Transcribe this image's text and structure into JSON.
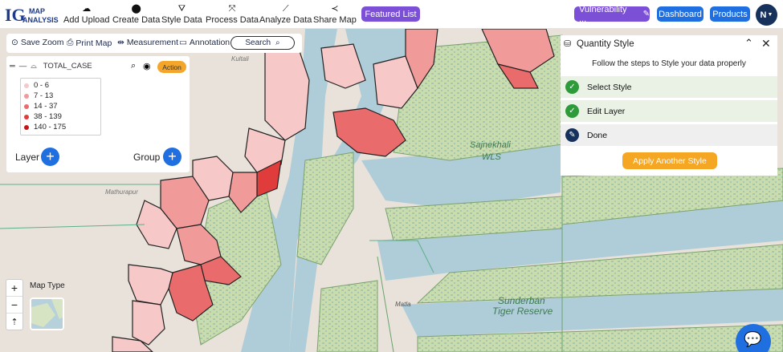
{
  "topbar": {
    "logo_main": "IG",
    "logo_line1": "MAP",
    "logo_line2": "ANALYSIS",
    "nav": [
      {
        "label": "Add Upload",
        "icon": "cloud-upload-icon"
      },
      {
        "label": "Create Data",
        "icon": "pin-icon"
      },
      {
        "label": "Style Data",
        "icon": "paint-bucket-icon"
      },
      {
        "label": "Process Data",
        "icon": "process-icon"
      },
      {
        "label": "Analyze Data",
        "icon": "analyze-icon"
      },
      {
        "label": "Share Map",
        "icon": "share-icon"
      }
    ],
    "featured": "Featured List",
    "project": "Vulnerability ...",
    "dashboard": "Dashboard",
    "products": "Products",
    "avatar": "N",
    "colors": {
      "featured": "#7b4fd6",
      "project": "#7b4fd6",
      "dashboard": "#1f6fe0",
      "products": "#1f6fe0"
    }
  },
  "tools": {
    "save_zoom": "Save Zoom",
    "print_map": "Print Map",
    "measurement": "Measurement",
    "annotation": "Annotation",
    "search": "Search"
  },
  "layer_panel": {
    "layer_name": "TOTAL_CASE",
    "action": "Action",
    "legend": [
      {
        "label": "0 - 6",
        "color": "#f6c8c8"
      },
      {
        "label": "7 - 13",
        "color": "#f19a9a"
      },
      {
        "label": "14 - 37",
        "color": "#ea6b6b"
      },
      {
        "label": "38 - 139",
        "color": "#e03c3c"
      },
      {
        "label": "140 - 175",
        "color": "#c81414"
      }
    ],
    "layer_label": "Layer",
    "group_label": "Group"
  },
  "quantity_style": {
    "title": "Quantity Style",
    "subtitle": "Follow the steps to Style your data properly",
    "steps": [
      {
        "label": "Select Style",
        "status": "done"
      },
      {
        "label": "Edit Layer",
        "status": "done"
      },
      {
        "label": "Done",
        "status": "current"
      }
    ],
    "apply": "Apply Another Style"
  },
  "map": {
    "labels": {
      "kultali": "Kultali",
      "mathurapur": "Mathurapur",
      "sajnekhali1": "Sajnekhali",
      "sajnekhali2": "WLS",
      "sunderban1": "Sunderban",
      "sunderban2": "Tiger Reserve",
      "matla": "Matla"
    },
    "map_type": "Map Type"
  }
}
